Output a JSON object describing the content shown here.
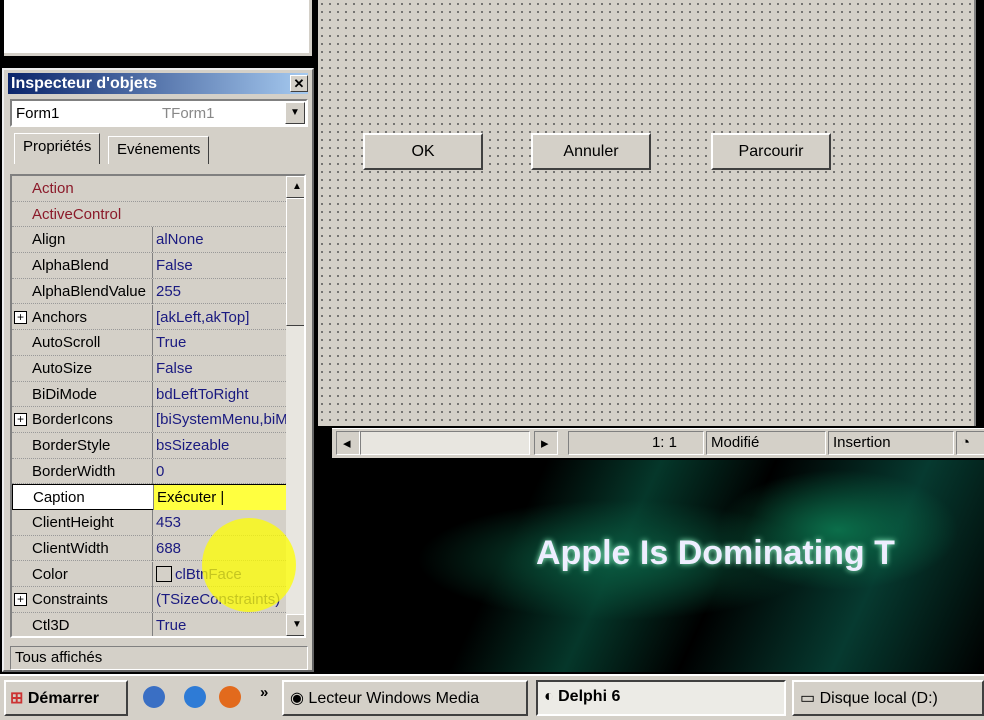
{
  "inspector": {
    "title": "Inspecteur d'objets",
    "object_name": "Form1",
    "object_type": "TForm1",
    "tabs": [
      "Propriétés",
      "Evénements"
    ],
    "properties": [
      {
        "name": "Action",
        "value": "",
        "ref": true
      },
      {
        "name": "ActiveControl",
        "value": "",
        "ref": true
      },
      {
        "name": "Align",
        "value": "alNone"
      },
      {
        "name": "AlphaBlend",
        "value": "False"
      },
      {
        "name": "AlphaBlendValue",
        "value": "255"
      },
      {
        "name": "Anchors",
        "value": "[akLeft,akTop]",
        "expand": true
      },
      {
        "name": "AutoScroll",
        "value": "True"
      },
      {
        "name": "AutoSize",
        "value": "False"
      },
      {
        "name": "BiDiMode",
        "value": "bdLeftToRight"
      },
      {
        "name": "BorderIcons",
        "value": "[biSystemMenu,biMinimize]",
        "expand": true
      },
      {
        "name": "BorderStyle",
        "value": "bsSizeable"
      },
      {
        "name": "BorderWidth",
        "value": "0"
      },
      {
        "name": "Caption",
        "value": "Exécuter",
        "selected": true
      },
      {
        "name": "ClientHeight",
        "value": "453"
      },
      {
        "name": "ClientWidth",
        "value": "688"
      },
      {
        "name": "Color",
        "value": "clBtnFace",
        "swatch": true
      },
      {
        "name": "Constraints",
        "value": "(TSizeConstraints)",
        "expand": true
      },
      {
        "name": "Ctl3D",
        "value": "True"
      }
    ],
    "status": "Tous affichés"
  },
  "form": {
    "buttons": [
      "OK",
      "Annuler",
      "Parcourir"
    ]
  },
  "editor_status": {
    "position": "1:  1",
    "modified": "Modifié",
    "mode": "Insertion"
  },
  "video": {
    "headline": "Apple Is Dominating T"
  },
  "taskbar": {
    "start": "Démarrer",
    "chevron": "»",
    "items": [
      "Lecteur Windows Media",
      "Delphi 6",
      "Disque local (D:)"
    ]
  }
}
